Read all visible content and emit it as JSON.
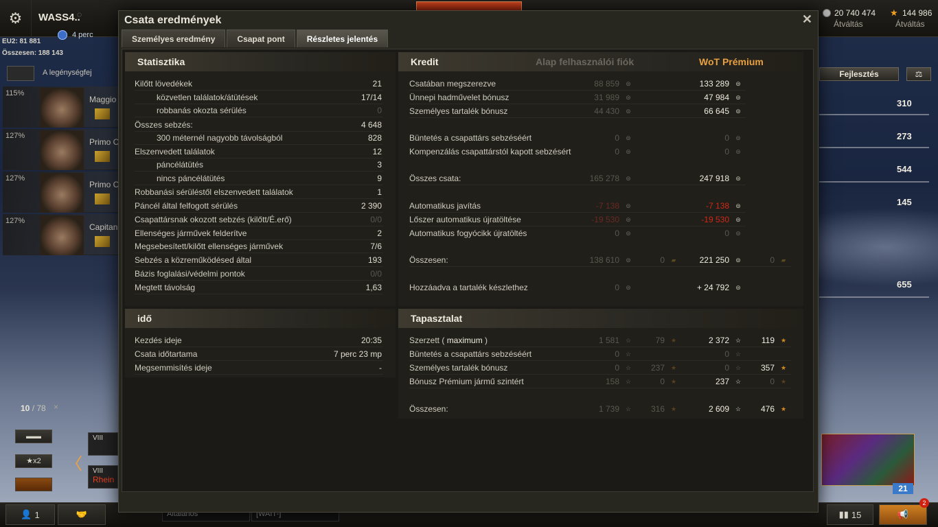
{
  "topbar": {
    "player_name": "WASS4..",
    "timer": "4 perc",
    "server_line": "EU2: 81 881",
    "online_line": "Összesen: 188 143",
    "credits": "20 740 474",
    "credits_label": "Átváltás",
    "gold": "144 986",
    "gold_label": "Átváltás"
  },
  "crew": {
    "title": "A legénységfej",
    "members": [
      {
        "pct": "115%",
        "name": "Maggio"
      },
      {
        "pct": "127%",
        "name": "Primo C"
      },
      {
        "pct": "127%",
        "name": "Primo C"
      },
      {
        "pct": "127%",
        "name": "Capitan"
      }
    ]
  },
  "carousel": {
    "counter_current": "10",
    "counter_total": "/ 78",
    "close": "×",
    "filter_x2": "★x2",
    "tank1_tier": "VIII",
    "tank2_tier": "VIII",
    "tank2_name": "Rhein"
  },
  "bottombar": {
    "squad_count": "1",
    "chat1": "Általános",
    "chat2": "[WAIT-]",
    "stats_count": "15",
    "notif_count": "2"
  },
  "right_panel": {
    "upgrade_label": "Fejlesztés",
    "stats": [
      "310",
      "273",
      "544",
      "145",
      "655"
    ],
    "chest_count": "21"
  },
  "dialog": {
    "title": "Csata eredmények",
    "close": "✕",
    "tabs": [
      "Személyes eredmény",
      "Csapat pont",
      "Részletes jelentés"
    ],
    "active_tab": 2,
    "statistics": {
      "header": "Statisztika",
      "rows": [
        {
          "label": "Kilőtt lövedékek",
          "value": "21",
          "indent": false,
          "dim": false
        },
        {
          "label": "közvetlen találatok/átütések",
          "value": "17/14",
          "indent": true,
          "dim": false
        },
        {
          "label": "robbanás okozta sérülés",
          "value": "0",
          "indent": true,
          "dim": true
        },
        {
          "label": "Összes sebzés:",
          "value": "4 648",
          "indent": false,
          "dim": false
        },
        {
          "label": "300 méternél nagyobb távolságból",
          "value": "828",
          "indent": true,
          "dim": false
        },
        {
          "label": "Elszenvedett találatok",
          "value": "12",
          "indent": false,
          "dim": false
        },
        {
          "label": "páncélátütés",
          "value": "3",
          "indent": true,
          "dim": false
        },
        {
          "label": "nincs páncélátütés",
          "value": "9",
          "indent": true,
          "dim": false
        },
        {
          "label": "Robbanási sérüléstől elszenvedett találatok",
          "value": "1",
          "indent": false,
          "dim": false
        },
        {
          "label": "Páncél által felfogott sérülés",
          "value": "2 390",
          "indent": false,
          "dim": false
        },
        {
          "label": "Csapattársnak okozott sebzés (kilőtt/É.erő)",
          "value": "0/0",
          "indent": false,
          "dim": true
        },
        {
          "label": "Ellenséges járművek felderítve",
          "value": "2",
          "indent": false,
          "dim": false
        },
        {
          "label": "Megsebesített/kilőtt ellenséges járművek",
          "value": "7/6",
          "indent": false,
          "dim": false
        },
        {
          "label": "Sebzés a közreműködésed által",
          "value": "193",
          "indent": false,
          "dim": false
        },
        {
          "label": "Bázis foglalási/védelmi pontok",
          "value": "0/0",
          "indent": false,
          "dim": true
        },
        {
          "label": "Megtett távolság",
          "value": "1,63",
          "indent": false,
          "dim": false
        }
      ]
    },
    "time": {
      "header": "idő",
      "rows": [
        {
          "label": "Kezdés ideje",
          "value": "20:35"
        },
        {
          "label": "Csata időtartama",
          "value": "7 perc 23 mp"
        },
        {
          "label": "Megsemmisítés ideje",
          "value": "-"
        }
      ]
    },
    "credit": {
      "header": "Kredit",
      "col_basic": "Alap felhasználói fiók",
      "col_premium": "WoT Prémium",
      "colors": {
        "premium_header": "#e8a040",
        "basic_header": "#6a675e",
        "negative": "#d02818"
      },
      "rows": [
        {
          "label": "Csatában megszerezve",
          "basic": "88 859",
          "premium": "133 289",
          "kind": "normal"
        },
        {
          "label": "Ünnepi hadművelet bónusz",
          "basic": "31 989",
          "premium": "47 984",
          "kind": "normal"
        },
        {
          "label": "Személyes tartalék bónusz",
          "basic": "44 430",
          "premium": "66 645",
          "kind": "normal"
        },
        {
          "label": "Büntetés a csapattárs sebzéséért",
          "basic": "0",
          "premium": "0",
          "kind": "zero"
        },
        {
          "label": "Kompenzálás csapattárstól kapott sebzésért",
          "basic": "0",
          "premium": "0",
          "kind": "zero"
        },
        {
          "label": "Összes csata:",
          "basic": "165 278",
          "premium": "247 918",
          "kind": "normal"
        },
        {
          "label": "Automatikus javítás",
          "basic": "-7 138",
          "premium": "-7 138",
          "kind": "negative"
        },
        {
          "label": "Lőszer automatikus újratöltése",
          "basic": "-19 530",
          "premium": "-19 530",
          "kind": "negative"
        },
        {
          "label": "Automatikus fogyócikk újratöltés",
          "basic": "0",
          "premium": "0",
          "kind": "zero"
        },
        {
          "label": "Összesen:",
          "basic": "138 610",
          "basic_gold": "0",
          "premium": "221 250",
          "premium_gold": "0",
          "kind": "total"
        },
        {
          "label": "Hozzáadva a tartalék készlethez",
          "basic": "0",
          "premium": "+ 24 792",
          "kind": "added"
        }
      ]
    },
    "experience": {
      "header": "Tapasztalat",
      "rows": [
        {
          "label": "Szerzett ( ",
          "label_bold": "maximum",
          "label_end": " )",
          "basic": "1 581",
          "basic_free": "79",
          "premium": "2 372",
          "premium_free": "119"
        },
        {
          "label": "Büntetés a csapattárs sebzéséért",
          "basic": "0",
          "basic_free": "",
          "premium": "0",
          "premium_free": ""
        },
        {
          "label": "Személyes tartalék bónusz",
          "basic": "0",
          "basic_free": "237",
          "premium": "0",
          "premium_free": "357"
        },
        {
          "label": "Bónusz Prémium jármű szintért",
          "basic": "158",
          "basic_free": "0",
          "premium": "237",
          "premium_free": "0"
        },
        {
          "label": "Összesen:",
          "basic": "1 739",
          "basic_free": "316",
          "premium": "2 609",
          "premium_free": "476"
        }
      ]
    }
  }
}
